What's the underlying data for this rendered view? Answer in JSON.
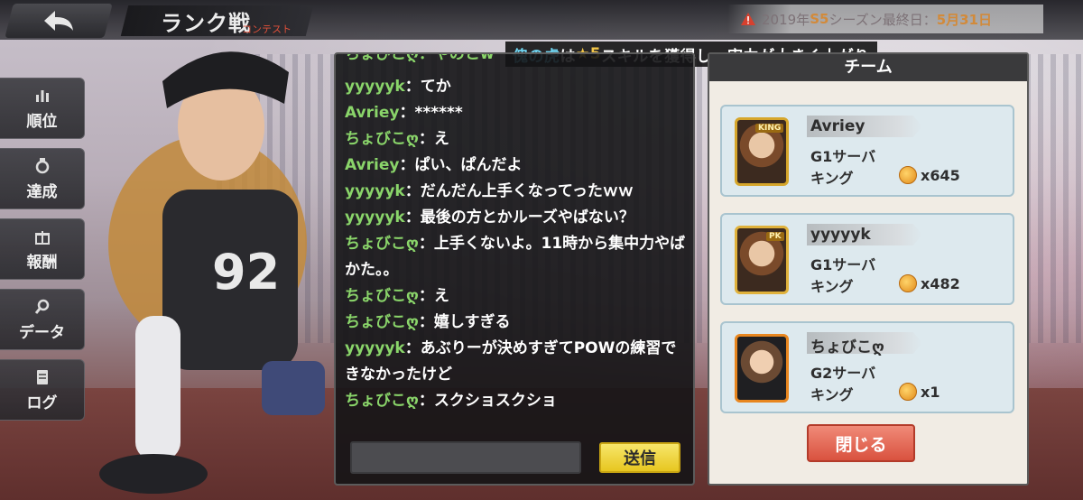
{
  "header": {
    "title": "ランク戦",
    "subtitle": "コンテスト",
    "season_prefix": "2019年",
    "season_id": "S5",
    "season_suffix": "シーズン最終日：",
    "season_date": "5月31日"
  },
  "notification": {
    "name": "傀の虎",
    "mid": "は",
    "star": "★5",
    "text": "スキルを獲得し、実力が大きく上がり"
  },
  "sidebar": {
    "items": [
      {
        "label": "順位",
        "icon": "bar-chart-icon"
      },
      {
        "label": "達成",
        "icon": "medal-icon"
      },
      {
        "label": "報酬",
        "icon": "gift-icon"
      },
      {
        "label": "データ",
        "icon": "magnifier-icon"
      },
      {
        "label": "ログ",
        "icon": "document-icon"
      }
    ]
  },
  "chat": {
    "partial_top": "ちょびこღ：やのとw",
    "messages": [
      {
        "name": "yyyyyk",
        "text": "：てか"
      },
      {
        "name": "Avriey",
        "text": "：******"
      },
      {
        "name": "ちょびこღ",
        "text": "：え"
      },
      {
        "name": "Avriey",
        "text": "：ぱい、ぱんだよ"
      },
      {
        "name": "yyyyyk",
        "text": "：だんだん上手くなってったｗｗ"
      },
      {
        "name": "yyyyyk",
        "text": "：最後の方とかルーズやばない？"
      },
      {
        "name": "ちょびこღ",
        "text": "：上手くないよ。11時から集中力やばかた。。"
      },
      {
        "name": "ちょびこღ",
        "text": "：え"
      },
      {
        "name": "ちょびこღ",
        "text": "：嬉しすぎる"
      },
      {
        "name": "yyyyyk",
        "text": "：あぶりーが決めすぎてPOWの練習できなかったけど"
      },
      {
        "name": "ちょびこღ",
        "text": "：スクショスクショ"
      }
    ],
    "input_value": "",
    "send_label": "送信"
  },
  "team": {
    "header": "チーム",
    "members": [
      {
        "name": "Avriey",
        "server": "G1サーバ",
        "rank": "キング",
        "coins": "x645",
        "badge": "KING"
      },
      {
        "name": "yyyyyk",
        "server": "G1サーバ",
        "rank": "キング",
        "coins": "x482",
        "badge": "PK"
      },
      {
        "name": "ちょびこღ",
        "server": "G2サーバ",
        "rank": "キング",
        "coins": "x1",
        "badge": ""
      }
    ],
    "close_label": "閉じる"
  },
  "colors": {
    "chat_name": "#8ad56a",
    "send_button": "#f0d640",
    "close_button": "#e06652",
    "season_highlight": "#d28a3a"
  }
}
